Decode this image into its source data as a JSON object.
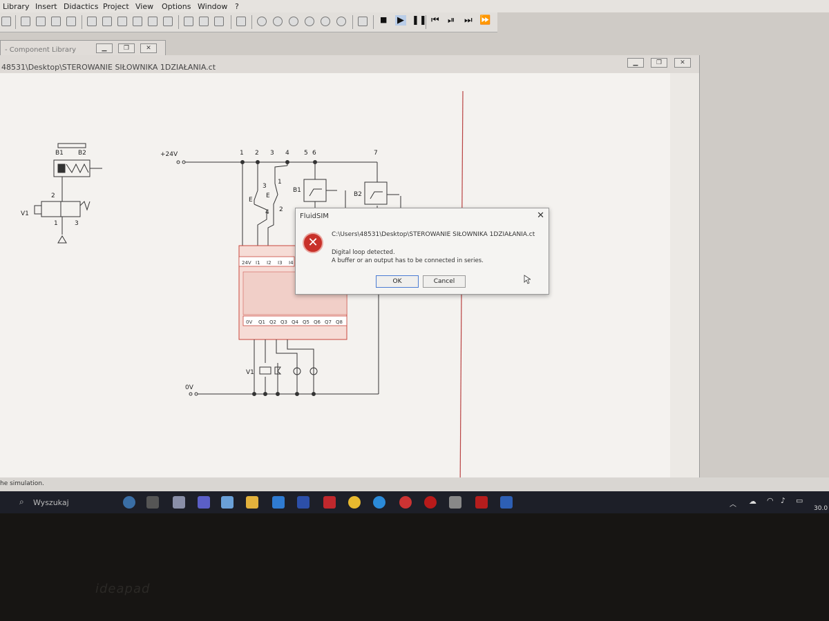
{
  "menu": [
    "Library",
    "Insert",
    "Didactics",
    "Project",
    "View",
    "Options",
    "Window",
    "?"
  ],
  "component_library": {
    "title": "- Component Library"
  },
  "document": {
    "title": "48531\\Desktop\\STEROWANIE SIŁOWNIKA 1DZIAŁANIA.ct"
  },
  "circuit": {
    "supply_plus": "+24V",
    "supply_zero": "0V",
    "rail_numbers": [
      "1",
      "2",
      "3",
      "4",
      "5",
      "6",
      "7"
    ],
    "pneumatic": {
      "sensor_b1": "B1",
      "sensor_b2": "B2",
      "valve": "V1",
      "port_2": "2",
      "port_1": "1",
      "port_3": "3"
    },
    "switch_s1_nums": [
      "3",
      "4"
    ],
    "switch_s2_nums": [
      "1",
      "2"
    ],
    "switch_tag": "E",
    "prox_b1": "B1",
    "prox_b2": "B2",
    "coil": "V1",
    "inputs": [
      "24V",
      "I1",
      "I2",
      "I3",
      "I4"
    ],
    "outputs": [
      "0V",
      "Q1",
      "Q2",
      "Q3",
      "Q4",
      "Q5",
      "Q6",
      "Q7",
      "Q8"
    ]
  },
  "dialog": {
    "title": "FluidSIM",
    "close": "✕",
    "path": "C:\\Users\\48531\\Desktop\\STEROWANIE SIŁOWNIKA 1DZIAŁANIA.ct",
    "line1": "Digital loop detected.",
    "line2": "A buffer or an output has to be connected in series.",
    "ok": "OK",
    "cancel": "Cancel"
  },
  "status_bar": "he simulation.",
  "taskbar": {
    "search": "Wyszukaj",
    "clock": "30.0"
  },
  "bezel_brand": "ideapad"
}
